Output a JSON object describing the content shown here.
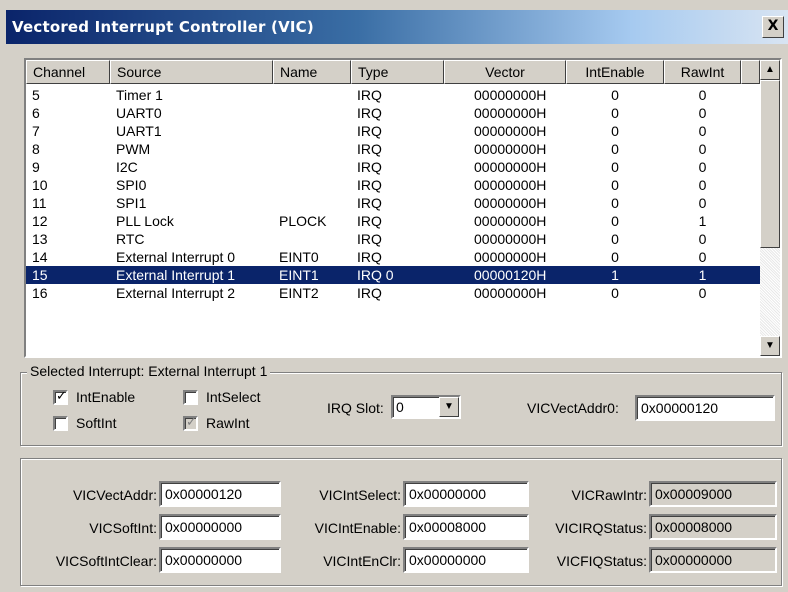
{
  "window": {
    "title": "Vectored Interrupt Controller (VIC)",
    "close_glyph": "X"
  },
  "table": {
    "columns": [
      "Channel",
      "Source",
      "Name",
      "Type",
      "Vector",
      "IntEnable",
      "RawInt"
    ],
    "rows": [
      {
        "channel": "5",
        "source": "Timer 1",
        "name": "",
        "type": "IRQ",
        "vector": "00000000H",
        "intenable": "0",
        "rawint": "0"
      },
      {
        "channel": "6",
        "source": "UART0",
        "name": "",
        "type": "IRQ",
        "vector": "00000000H",
        "intenable": "0",
        "rawint": "0"
      },
      {
        "channel": "7",
        "source": "UART1",
        "name": "",
        "type": "IRQ",
        "vector": "00000000H",
        "intenable": "0",
        "rawint": "0"
      },
      {
        "channel": "8",
        "source": "PWM",
        "name": "",
        "type": "IRQ",
        "vector": "00000000H",
        "intenable": "0",
        "rawint": "0"
      },
      {
        "channel": "9",
        "source": "I2C",
        "name": "",
        "type": "IRQ",
        "vector": "00000000H",
        "intenable": "0",
        "rawint": "0"
      },
      {
        "channel": "10",
        "source": "SPI0",
        "name": "",
        "type": "IRQ",
        "vector": "00000000H",
        "intenable": "0",
        "rawint": "0"
      },
      {
        "channel": "11",
        "source": "SPI1",
        "name": "",
        "type": "IRQ",
        "vector": "00000000H",
        "intenable": "0",
        "rawint": "0"
      },
      {
        "channel": "12",
        "source": "PLL Lock",
        "name": "PLOCK",
        "type": "IRQ",
        "vector": "00000000H",
        "intenable": "0",
        "rawint": "1"
      },
      {
        "channel": "13",
        "source": "RTC",
        "name": "",
        "type": "IRQ",
        "vector": "00000000H",
        "intenable": "0",
        "rawint": "0"
      },
      {
        "channel": "14",
        "source": "External Interrupt 0",
        "name": "EINT0",
        "type": "IRQ",
        "vector": "00000000H",
        "intenable": "0",
        "rawint": "0"
      },
      {
        "channel": "15",
        "source": "External Interrupt 1",
        "name": "EINT1",
        "type": "IRQ 0",
        "vector": "00000120H",
        "intenable": "1",
        "rawint": "1",
        "selected": true
      },
      {
        "channel": "16",
        "source": "External Interrupt 2",
        "name": "EINT2",
        "type": "IRQ",
        "vector": "00000000H",
        "intenable": "0",
        "rawint": "0"
      }
    ]
  },
  "selected_group": {
    "legend": "Selected Interrupt: External Interrupt 1",
    "intenable_label": "IntEnable",
    "intenable_checked": true,
    "intselect_label": "IntSelect",
    "intselect_checked": false,
    "softint_label": "SoftInt",
    "softint_checked": false,
    "rawint_label": "RawInt",
    "rawint_checked": true,
    "irq_slot_label": "IRQ Slot:",
    "irq_slot_value": "0",
    "vectaddr0_label": "VICVectAddr0:",
    "vectaddr0_value": "0x00000120"
  },
  "registers": {
    "vectaddr_label": "VICVectAddr:",
    "vectaddr_value": "0x00000120",
    "intselect_label": "VICIntSelect:",
    "intselect_value": "0x00000000",
    "rawintr_label": "VICRawIntr:",
    "rawintr_value": "0x00009000",
    "softint_label": "VICSoftInt:",
    "softint_value": "0x00000000",
    "intenable_label": "VICIntEnable:",
    "intenable_value": "0x00008000",
    "irqstatus_label": "VICIRQStatus:",
    "irqstatus_value": "0x00008000",
    "softintclear_label": "VICSoftIntClear:",
    "softintclear_value": "0x00000000",
    "intenclr_label": "VICIntEnClr:",
    "intenclr_value": "0x00000000",
    "fiqstatus_label": "VICFIQStatus:",
    "fiqstatus_value": "0x00000000"
  },
  "icons": {
    "scroll_up": "up-arrow-icon",
    "scroll_down": "down-arrow-icon",
    "combo_arrow": "chevron-down-icon",
    "check": "checkmark-icon"
  }
}
